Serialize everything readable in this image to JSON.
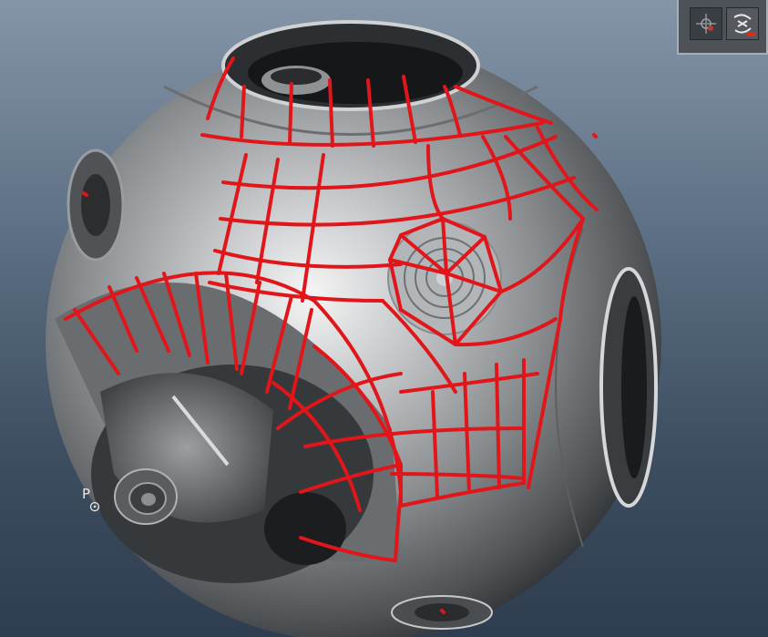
{
  "viewport": {
    "background_top": "#8595a8",
    "background_bottom": "#2e3d4f",
    "model_color": "#b5b8bb",
    "stroke_color": "#e0161a"
  },
  "pivot": {
    "label": "P",
    "icon": "pivot-target-icon"
  },
  "mini_toolbar": {
    "buttons": [
      {
        "icon": "move-manipulator-icon"
      },
      {
        "icon": "rotate-manipulator-icon"
      }
    ]
  }
}
